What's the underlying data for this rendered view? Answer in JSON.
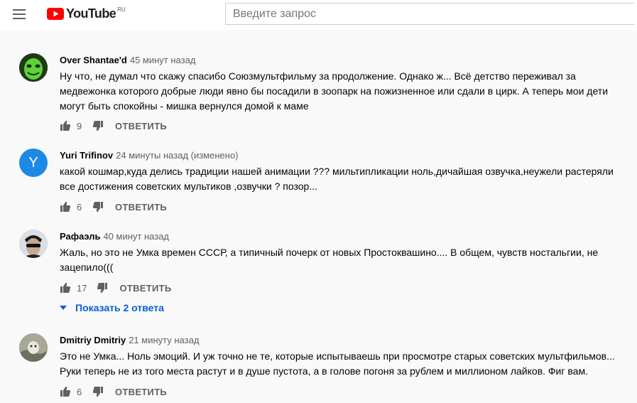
{
  "header": {
    "logo_text": "YouTube",
    "logo_country": "RU",
    "search_placeholder": "Введите запрос"
  },
  "colors": {
    "brand_red": "#ff0000",
    "link_blue": "#065fd4",
    "secondary_text": "#606060"
  },
  "comments": [
    {
      "author": "Over Shantae'd",
      "time": "45 минут назад",
      "text": "Ну что, не думал что скажу спасибо  Союзмультфильму за продолжение. Однако ж... Всё детство переживал за\nмедвежонка которого добрые люди явно бы посадили в зоопарк на пожизненное или сдали в цирк. А теперь мои дети\nмогут быть спокойны - мишка вернулся домой к маме",
      "likes": "9",
      "reply": "ОТВЕТИТЬ"
    },
    {
      "author": "Yuri Trifinov",
      "time": "24 минуты назад (изменено)",
      "avatar_letter": "Y",
      "text": "какой кошмар,куда делись традиции нашей анимации ??? мильтипликации ноль,дичайшая озвучка,неужели растеряли\nвсе достижения советских мультиков ,озвучки ? позор...",
      "likes": "6",
      "reply": "ОТВЕТИТЬ"
    },
    {
      "author": "Рафаэль",
      "time": "40 минут назад",
      "text": "Жаль, но это не Умка времен СССР, а типичный почерк от новых Простоквашино.... В общем, чувств ностальгии, не\nзацепило(((",
      "likes": "17",
      "reply": "ОТВЕТИТЬ",
      "show_replies": "Показать 2 ответа"
    },
    {
      "author": "Dmitriy Dmitriy",
      "time": "21 минуту назад",
      "text": "Это не Умка... Ноль эмоций. И уж точно не те, которые испытываешь при просмотре старых советских мультфильмов...\nРуки теперь не из того места растут и в душе пустота, а в голове погоня за рублем и миллионом лайков. Фиг вам.",
      "likes": "6",
      "reply": "ОТВЕТИТЬ"
    }
  ]
}
